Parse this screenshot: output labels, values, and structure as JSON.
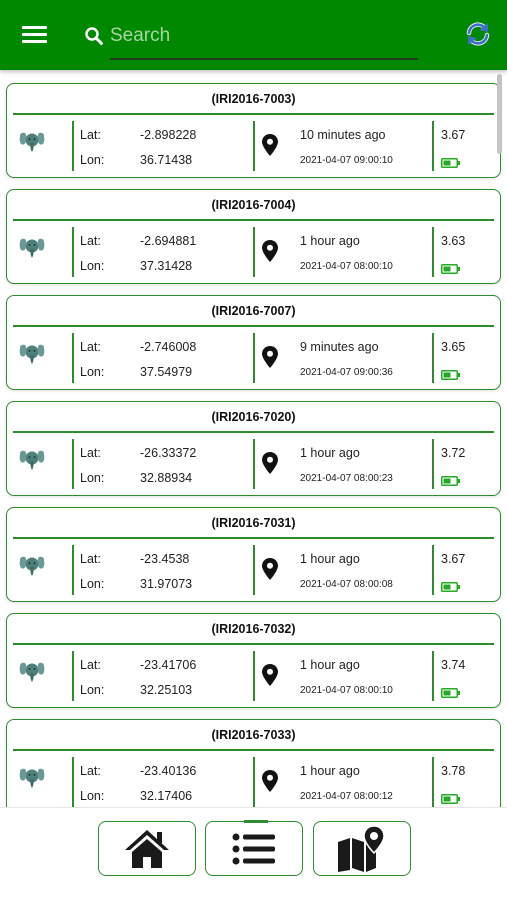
{
  "header": {
    "search_placeholder": "Search",
    "brand_color": "#008800",
    "icons": [
      "menu-icon",
      "search-icon",
      "refresh-icon"
    ]
  },
  "labels": {
    "lat": "Lat:",
    "lon": "Lon:"
  },
  "devices": [
    {
      "id": "(IRI2016-7003)",
      "lat": "-2.898228",
      "lon": "36.71438",
      "ago": "10 minutes ago",
      "timestamp": "2021-04-07 09:00:10",
      "voltage": "3.67"
    },
    {
      "id": "(IRI2016-7004)",
      "lat": "-2.694881",
      "lon": "37.31428",
      "ago": "1 hour ago",
      "timestamp": "2021-04-07 08:00:10",
      "voltage": "3.63"
    },
    {
      "id": "(IRI2016-7007)",
      "lat": "-2.746008",
      "lon": "37.54979",
      "ago": "9 minutes ago",
      "timestamp": "2021-04-07 09:00:36",
      "voltage": "3.65"
    },
    {
      "id": "(IRI2016-7020)",
      "lat": "-26.33372",
      "lon": "32.88934",
      "ago": "1 hour ago",
      "timestamp": "2021-04-07 08:00:23",
      "voltage": "3.72"
    },
    {
      "id": "(IRI2016-7031)",
      "lat": "-23.4538",
      "lon": "31.97073",
      "ago": "1 hour ago",
      "timestamp": "2021-04-07 08:00:08",
      "voltage": "3.67"
    },
    {
      "id": "(IRI2016-7032)",
      "lat": "-23.41706",
      "lon": "32.25103",
      "ago": "1 hour ago",
      "timestamp": "2021-04-07 08:00:10",
      "voltage": "3.74"
    },
    {
      "id": "(IRI2016-7033)",
      "lat": "-23.40136",
      "lon": "32.17406",
      "ago": "1 hour ago",
      "timestamp": "2021-04-07 08:00:12",
      "voltage": "3.78"
    }
  ],
  "bottom_nav": {
    "items": [
      "home-icon",
      "list-icon",
      "map-icon"
    ],
    "active": "list-icon"
  }
}
